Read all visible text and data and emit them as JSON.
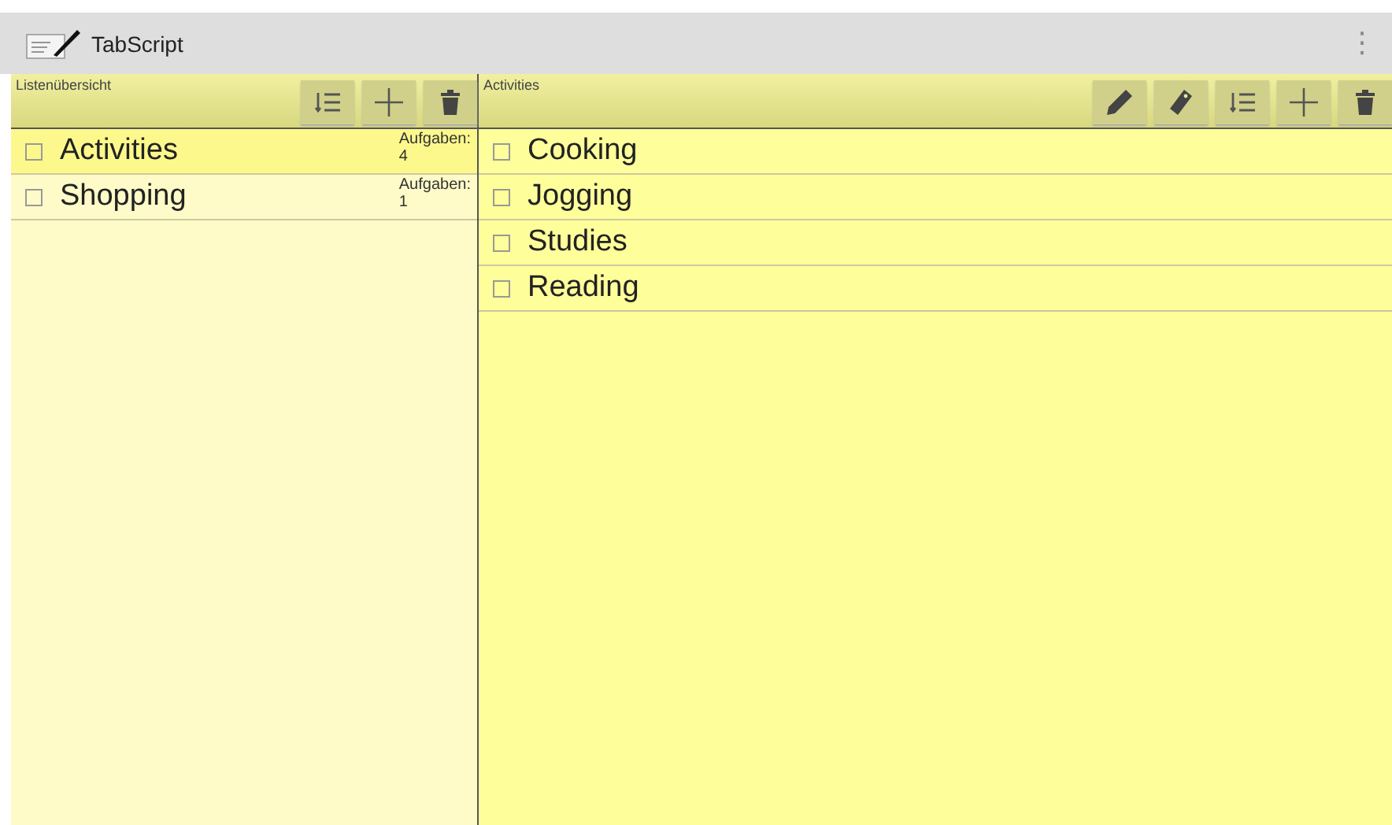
{
  "app_bar": {
    "title": "TabScript",
    "menu": "⋮"
  },
  "lists_panel": {
    "title": "Listenübersicht",
    "toolbar": [
      {
        "kind": "sort"
      },
      {
        "kind": "add"
      },
      {
        "kind": "delete"
      }
    ],
    "items": [
      {
        "name": "Activities",
        "count_label": "Aufgaben:",
        "count": "4",
        "checked": false,
        "selected": true
      },
      {
        "name": "Shopping",
        "count_label": "Aufgaben:",
        "count": "1",
        "checked": false,
        "selected": false
      }
    ]
  },
  "tasks_panel": {
    "title": "Activities",
    "toolbar": [
      {
        "kind": "edit"
      },
      {
        "kind": "tag"
      },
      {
        "kind": "sort"
      },
      {
        "kind": "add"
      },
      {
        "kind": "delete"
      }
    ],
    "items": [
      {
        "name": "Cooking",
        "checked": false
      },
      {
        "name": "Jogging",
        "checked": false
      },
      {
        "name": "Studies",
        "checked": false
      },
      {
        "name": "Reading",
        "checked": false
      }
    ]
  }
}
